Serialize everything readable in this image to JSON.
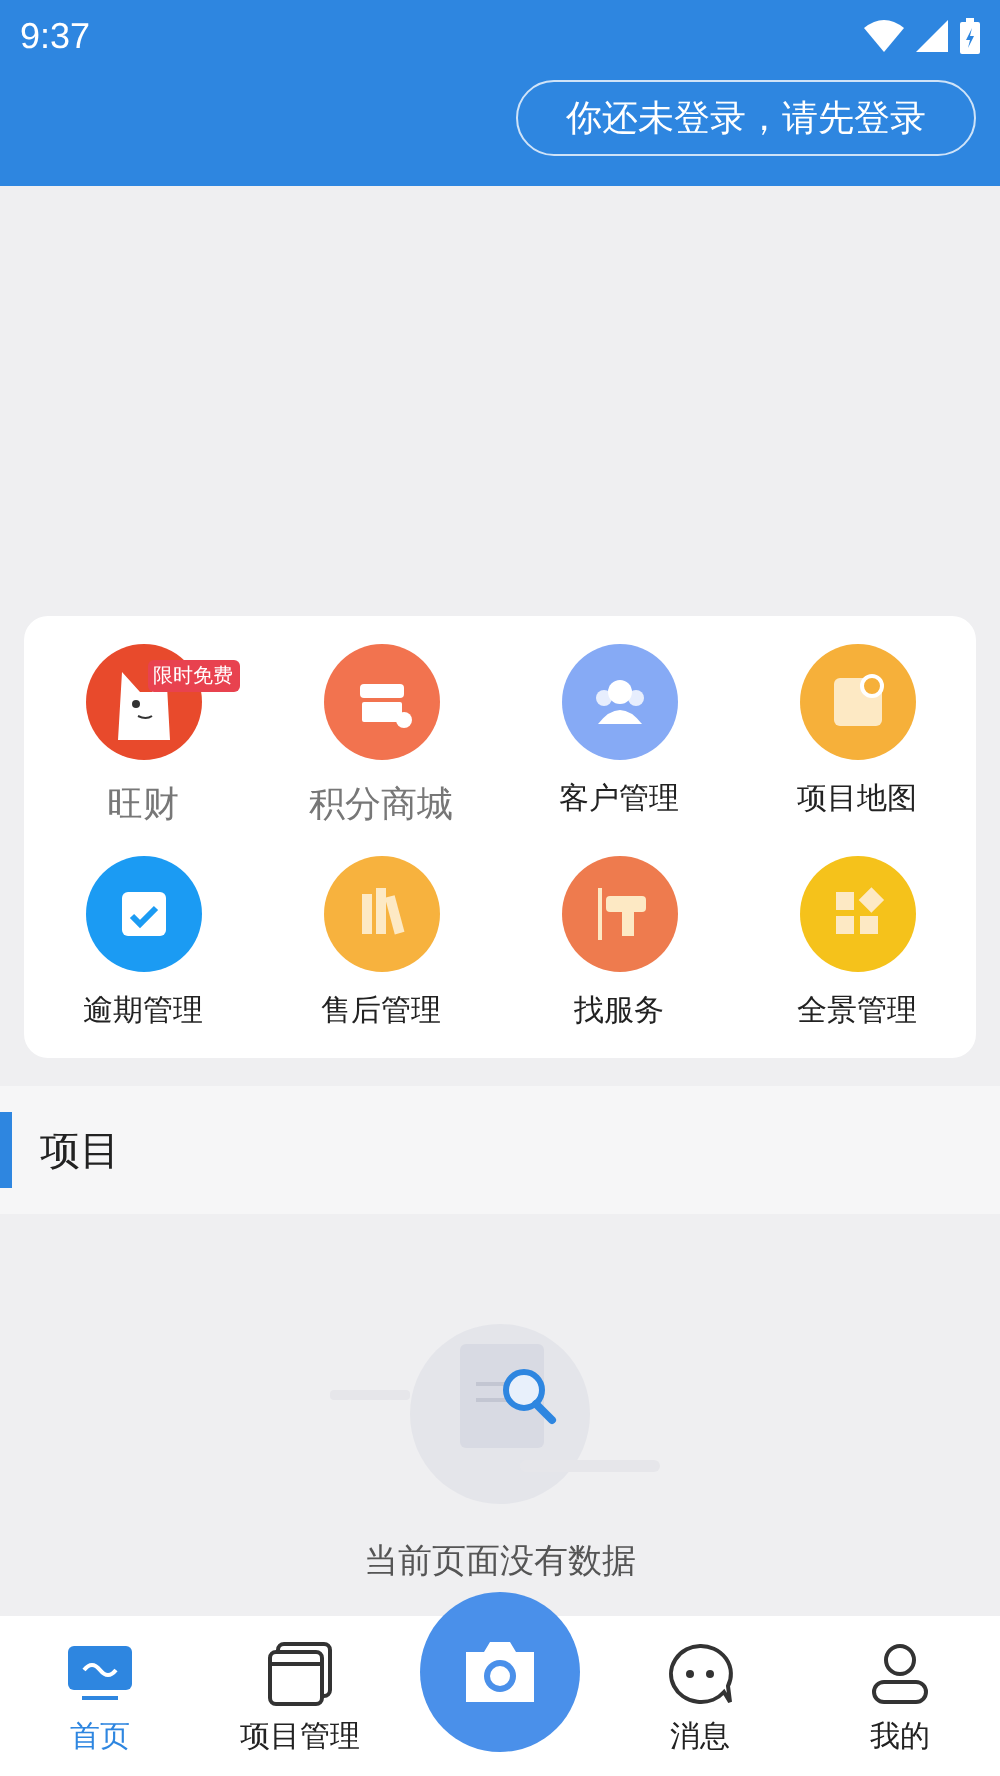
{
  "status_bar": {
    "time": "9:37"
  },
  "header": {
    "login_button": "你还未登录，请先登录"
  },
  "shortcuts": [
    {
      "label": "旺财",
      "muted": true,
      "badge": "限时免费"
    },
    {
      "label": "积分商城",
      "muted": true
    },
    {
      "label": "客户管理",
      "muted": false
    },
    {
      "label": "项目地图",
      "muted": false
    },
    {
      "label": "逾期管理",
      "muted": false
    },
    {
      "label": "售后管理",
      "muted": false
    },
    {
      "label": "找服务",
      "muted": false
    },
    {
      "label": "全景管理",
      "muted": false
    }
  ],
  "section": {
    "title": "项目"
  },
  "empty_state": {
    "message": "当前页面没有数据"
  },
  "tab_bar": [
    {
      "label": "首页",
      "selected": true
    },
    {
      "label": "项目管理",
      "selected": false
    },
    {
      "kind": "camera"
    },
    {
      "label": "消息",
      "selected": false
    },
    {
      "label": "我的",
      "selected": false
    }
  ]
}
